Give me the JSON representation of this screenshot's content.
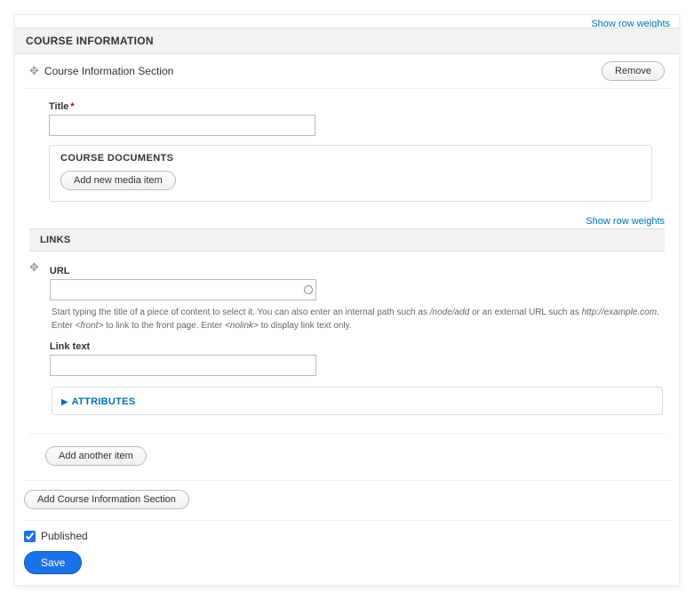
{
  "top_link_partial": "Show row weights",
  "section_header": "COURSE INFORMATION",
  "row": {
    "title": "Course Information Section",
    "remove_label": "Remove"
  },
  "title_field": {
    "label": "Title",
    "value": ""
  },
  "documents": {
    "legend": "COURSE DOCUMENTS",
    "add_media_label": "Add new media item"
  },
  "show_row_weights": "Show row weights",
  "links": {
    "legend": "LINKS",
    "url_label": "URL",
    "url_value": "",
    "helper_pre": "Start typing the title of a piece of content to select it. You can also enter an internal path such as ",
    "helper_path": "/node/add",
    "helper_mid1": " or an external URL such as ",
    "helper_url": "http://example.com",
    "helper_mid2": ". Enter ",
    "helper_front": "<front>",
    "helper_mid3": " to link to the front page. Enter ",
    "helper_nolink": "<nolink>",
    "helper_post": " to display link text only.",
    "linktext_label": "Link text",
    "linktext_value": "",
    "attributes_label": "ATTRIBUTES"
  },
  "add_another_label": "Add another item",
  "add_section_label": "Add Course Information Section",
  "published": {
    "label": "Published",
    "checked": true
  },
  "save_label": "Save"
}
